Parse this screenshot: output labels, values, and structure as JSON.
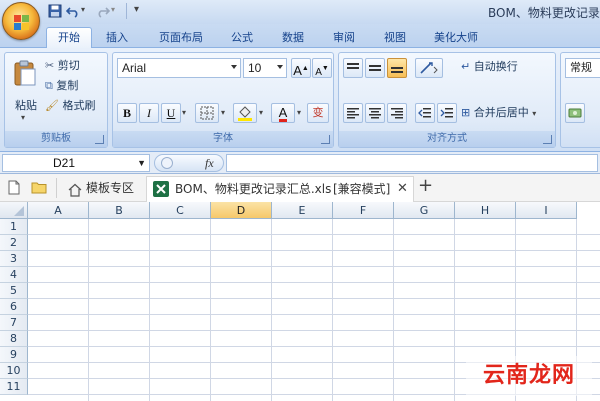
{
  "window": {
    "title": "BOM、物料更改记录"
  },
  "qat": {
    "save": "save-icon",
    "undo": "undo-icon",
    "redo": "redo-icon",
    "customize": "▾"
  },
  "tabs": [
    "开始",
    "插入",
    "页面布局",
    "公式",
    "数据",
    "审阅",
    "视图",
    "美化大师"
  ],
  "clipboard": {
    "paste": "粘贴",
    "cut": "剪切",
    "copy": "复制",
    "format_painter": "格式刷",
    "label": "剪贴板"
  },
  "font": {
    "name": "Arial",
    "size": "10",
    "label": "字体",
    "grow": "A",
    "shrink": "A",
    "bold": "B",
    "italic": "I",
    "underline": "U",
    "font_color_glyph": "A",
    "phonetic": "变"
  },
  "alignment": {
    "wrap_text": "自动换行",
    "merge_center": "合并后居中",
    "label": "对齐方式"
  },
  "number": {
    "format": "常规"
  },
  "formula_bar": {
    "name_box": "D21",
    "fx": "fx",
    "formula": ""
  },
  "doc_tabs": {
    "template_zone": "模板专区",
    "file_name": "BOM、物料更改记录汇总.xls",
    "mode": "[兼容模式]",
    "close": "✕",
    "new": "+"
  },
  "grid": {
    "columns": [
      "A",
      "B",
      "C",
      "D",
      "E",
      "F",
      "G",
      "H",
      "I"
    ],
    "selected_column": "D",
    "rows": [
      "1",
      "2",
      "3",
      "4",
      "5",
      "6",
      "7",
      "8",
      "9",
      "10",
      "11"
    ]
  },
  "watermark": "云南龙网",
  "colors": {
    "accent": "#15428b",
    "selected_header": "#f6c86a",
    "excel_green": "#1d7044",
    "watermark": "#e2261b"
  }
}
